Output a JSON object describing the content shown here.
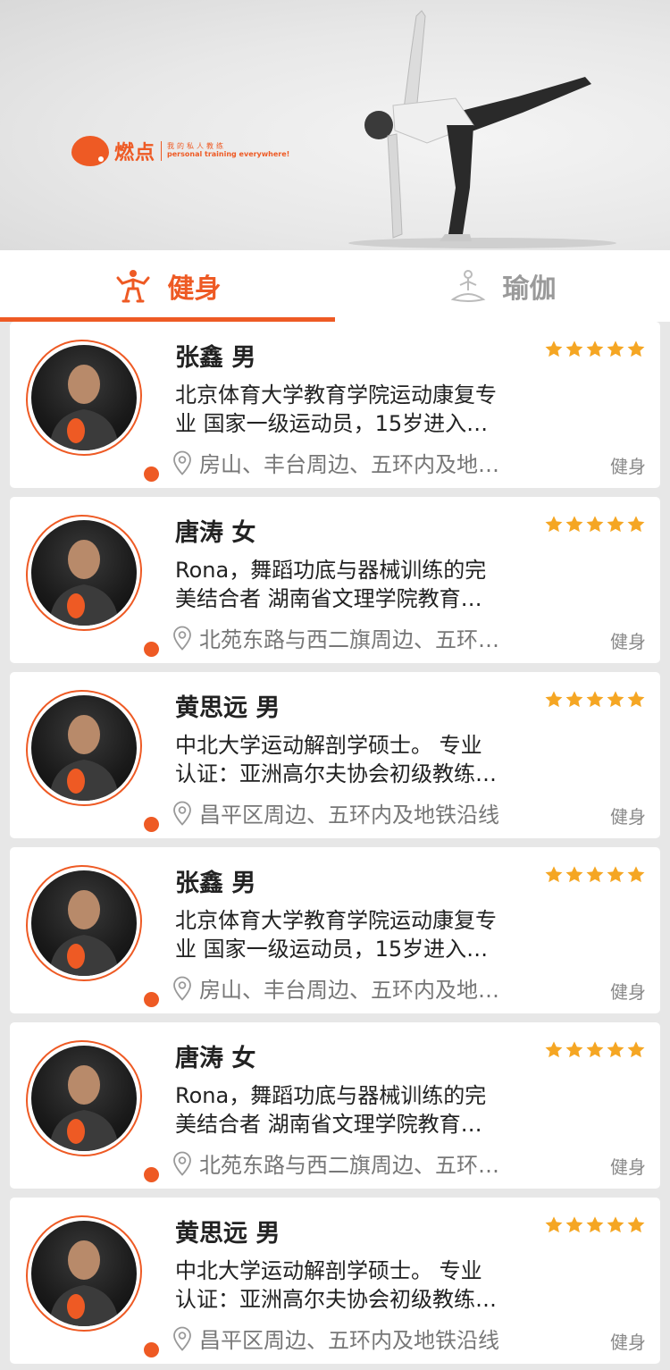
{
  "brand": {
    "name": "燃点",
    "slogan_cn": "我的私人教练",
    "slogan_en": "personal training everywhere!",
    "accent": "#ee5a24"
  },
  "tabs": [
    {
      "label": "健身",
      "icon": "fitness-icon",
      "active": true
    },
    {
      "label": "瑜伽",
      "icon": "yoga-icon",
      "active": false
    }
  ],
  "trainers": [
    {
      "name": "张鑫   男",
      "rating": 5,
      "desc_line1": "北京体育大学教育学院运动康复专",
      "desc_line2": "业 国家一级运动员，15岁进入…",
      "location": "房山、丰台周边、五环内及地…",
      "tag": "健身"
    },
    {
      "name": "唐涛   女",
      "rating": 5,
      "desc_line1": "Rona，舞蹈功底与器械训练的完",
      "desc_line2": "美结合者 湖南省文理学院教育…",
      "location": "北苑东路与西二旗周边、五环…",
      "tag": "健身"
    },
    {
      "name": "黄思远   男",
      "rating": 5,
      "desc_line1": "中北大学运动解剖学硕士。 专业",
      "desc_line2": "认证：亚洲高尔夫协会初级教练…",
      "location": "昌平区周边、五环内及地铁沿线",
      "tag": "健身"
    },
    {
      "name": "张鑫   男",
      "rating": 5,
      "desc_line1": "北京体育大学教育学院运动康复专",
      "desc_line2": "业 国家一级运动员，15岁进入…",
      "location": "房山、丰台周边、五环内及地…",
      "tag": "健身"
    },
    {
      "name": "唐涛   女",
      "rating": 5,
      "desc_line1": "Rona，舞蹈功底与器械训练的完",
      "desc_line2": "美结合者 湖南省文理学院教育…",
      "location": "北苑东路与西二旗周边、五环…",
      "tag": "健身"
    },
    {
      "name": "黄思远   男",
      "rating": 5,
      "desc_line1": "中北大学运动解剖学硕士。 专业",
      "desc_line2": "认证：亚洲高尔夫协会初级教练…",
      "location": "昌平区周边、五环内及地铁沿线",
      "tag": "健身"
    }
  ]
}
